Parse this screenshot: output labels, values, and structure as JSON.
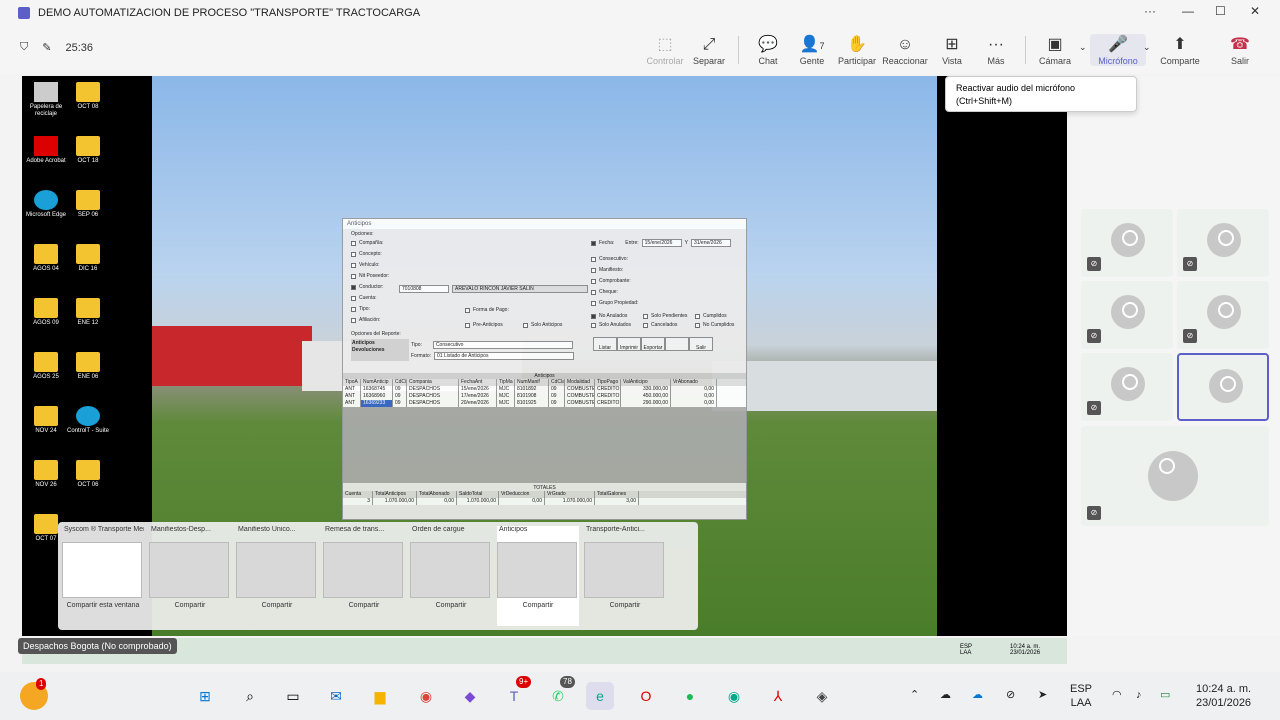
{
  "window": {
    "title": "DEMO AUTOMATIZACION DE PROCESO \"TRANSPORTE\" TRACTOCARGA",
    "minimize": "—",
    "maximize": "☐",
    "close": "✕",
    "more": "···"
  },
  "meeting": {
    "timer": "25:36"
  },
  "toolbar": [
    {
      "id": "controlar",
      "label": "Controlar",
      "icon": "⬚",
      "disabled": true
    },
    {
      "id": "separar",
      "label": "Separar",
      "icon": "⤢"
    },
    {
      "id": "chat",
      "label": "Chat",
      "icon": "💬"
    },
    {
      "id": "gente",
      "label": "Gente",
      "icon": "👤",
      "count": "7"
    },
    {
      "id": "participar",
      "label": "Participar",
      "icon": "✋"
    },
    {
      "id": "reaccionar",
      "label": "Reaccionar",
      "icon": "☺"
    },
    {
      "id": "vista",
      "label": "Vista",
      "icon": "⊞"
    },
    {
      "id": "mas",
      "label": "Más",
      "icon": "···"
    },
    {
      "id": "camara",
      "label": "Cámara",
      "icon": "▣"
    },
    {
      "id": "microfono",
      "label": "Micrófono",
      "icon": "🎤"
    },
    {
      "id": "comparte",
      "label": "Comparte",
      "icon": "⬆"
    },
    {
      "id": "salir",
      "label": "Salir",
      "icon": "☎"
    }
  ],
  "tooltip": {
    "line1": "Reactivar audio del micrófono",
    "line2": "(Ctrl+Shift+M)"
  },
  "desktop": [
    {
      "label": "Papelera de reciclaje",
      "type": "bin"
    },
    {
      "label": "OCT 08",
      "type": "folder"
    },
    {
      "label": "Adobe Acrobat",
      "type": "app"
    },
    {
      "label": "OCT 18",
      "type": "folder"
    },
    {
      "label": "Microsoft Edge",
      "type": "edge"
    },
    {
      "label": "SEP 06",
      "type": "folder"
    },
    {
      "label": "AGOS 04",
      "type": "folder"
    },
    {
      "label": "DIC 16",
      "type": "folder"
    },
    {
      "label": "AGOS 09",
      "type": "folder"
    },
    {
      "label": "ENE 12",
      "type": "folder"
    },
    {
      "label": "AGOS 25",
      "type": "folder"
    },
    {
      "label": "ENE 06",
      "type": "folder"
    },
    {
      "label": "NOV 24",
      "type": "folder"
    },
    {
      "label": "ControlT - Suite",
      "type": "edge"
    },
    {
      "label": "NOV 26",
      "type": "folder"
    },
    {
      "label": "OCT 06",
      "type": "folder"
    },
    {
      "label": "OCT 07",
      "type": "folder"
    }
  ],
  "anticipos": {
    "title": "Anticipos",
    "opciones_label": "Opciones:",
    "left_opts": [
      "Compañía:",
      "Concepto:",
      "Vehículo:",
      "Nit Poseedor:",
      "Conductor:",
      "Cuenta:",
      "Tipo:",
      "Afiliación:"
    ],
    "conductor_code": "7010808",
    "conductor_name": "AREVALO RINCON JAVIER SALIN",
    "forma_pago": "Forma de Pago:",
    "pre_anticipos": "Pre-Anticipos",
    "solo_anticipos": "Solo Anticipos",
    "fecha_label": "Fecha:",
    "entre": "Entre:",
    "fecha_desde": "15/ene/2026",
    "y": "Y",
    "fecha_hasta": "31/ene/2026",
    "right_opts": [
      "Consecutivo:",
      "Manifiesto:",
      "Comprobante:",
      "Cheque:",
      "Grupo Propiedad:"
    ],
    "status_opts": [
      "No Anulados",
      "Solo Pendientes",
      "Cumplidos",
      "Solo Anulados",
      "Cancelados",
      "No Cumplidos"
    ],
    "reporte_label": "Opciones del Reporte:",
    "rep_opts": [
      "Anticipos",
      "Devoluciones"
    ],
    "tipo_label": "Tipo:",
    "tipo_val": "Consecutivo",
    "formato_label": "Formato:",
    "formato_val": "01 Listado de Anticipos",
    "buttons": [
      "Listar",
      "Imprimir",
      "Exportar",
      "",
      "Salir"
    ],
    "grid_title": "Anticipos",
    "columns": [
      "TipoA",
      "NumAnticip",
      "CdCia",
      "Compania",
      "FechaAnt",
      "TipMa",
      "NumManif",
      "CdClaM",
      "Modalidad",
      "TipoPago",
      "ValAnticipo",
      "VrAbonado"
    ],
    "rows": [
      [
        "ANT",
        "16368745",
        "09",
        "DESPACHOS",
        "15/ene/2026",
        "MJC",
        "8101892",
        "09",
        "COMBUSTE",
        "CREDITO",
        "330.000,00",
        "0,00"
      ],
      [
        "ANT",
        "16368960",
        "09",
        "DESPACHOS",
        "17/ene/2026",
        "MJC",
        "8101908",
        "09",
        "COMBUSTE",
        "CREDITO",
        "450.000,00",
        "0,00"
      ],
      [
        "ANT",
        "16369233",
        "09",
        "DESPACHOS",
        "20/ene/2026",
        "MJC",
        "8101925",
        "09",
        "COMBUSTE",
        "CREDITO",
        "290.000,00",
        "0,00"
      ]
    ],
    "totals_title": "TOTALES",
    "totals_cols": [
      "Cuenta",
      "TotalAnticipos",
      "TotalAbonado",
      "SaldoTotal",
      "VrDeduccion",
      "VrGrado",
      "TotalGalones"
    ],
    "totals_row": [
      "3",
      "1.070.000,00",
      "0,00",
      "1.070.000,00",
      "0,00",
      "1.070.000,00",
      "3,00"
    ]
  },
  "share_thumbs": [
    {
      "title": "Syscom ® Transporte Men...",
      "share": "Compartir esta ventana"
    },
    {
      "title": "Manifiestos-Desp...",
      "share": "Compartir"
    },
    {
      "title": "Manifiesto Unico...",
      "share": "Compartir"
    },
    {
      "title": "Remesa de trans...",
      "share": "Compartir"
    },
    {
      "title": "Orden de cargue",
      "share": "Compartir"
    },
    {
      "title": "Anticipos",
      "share": "Compartir",
      "active": true
    },
    {
      "title": "Transporte-Antici...",
      "share": "Compartir"
    }
  ],
  "remote_taskbar": {
    "lang1": "ESP",
    "lang2": "LAA",
    "time": "10:24 a. m.",
    "date": "23/01/2026"
  },
  "presenter_tag": "Despachos Bogota (No comprobado)",
  "taskbar": {
    "lang1": "ESP",
    "lang2": "LAA",
    "time": "10:24 a. m.",
    "date": "23/01/2026",
    "badge_teams": "9+",
    "badge_whatsapp": "78",
    "badge_weather": "1"
  }
}
